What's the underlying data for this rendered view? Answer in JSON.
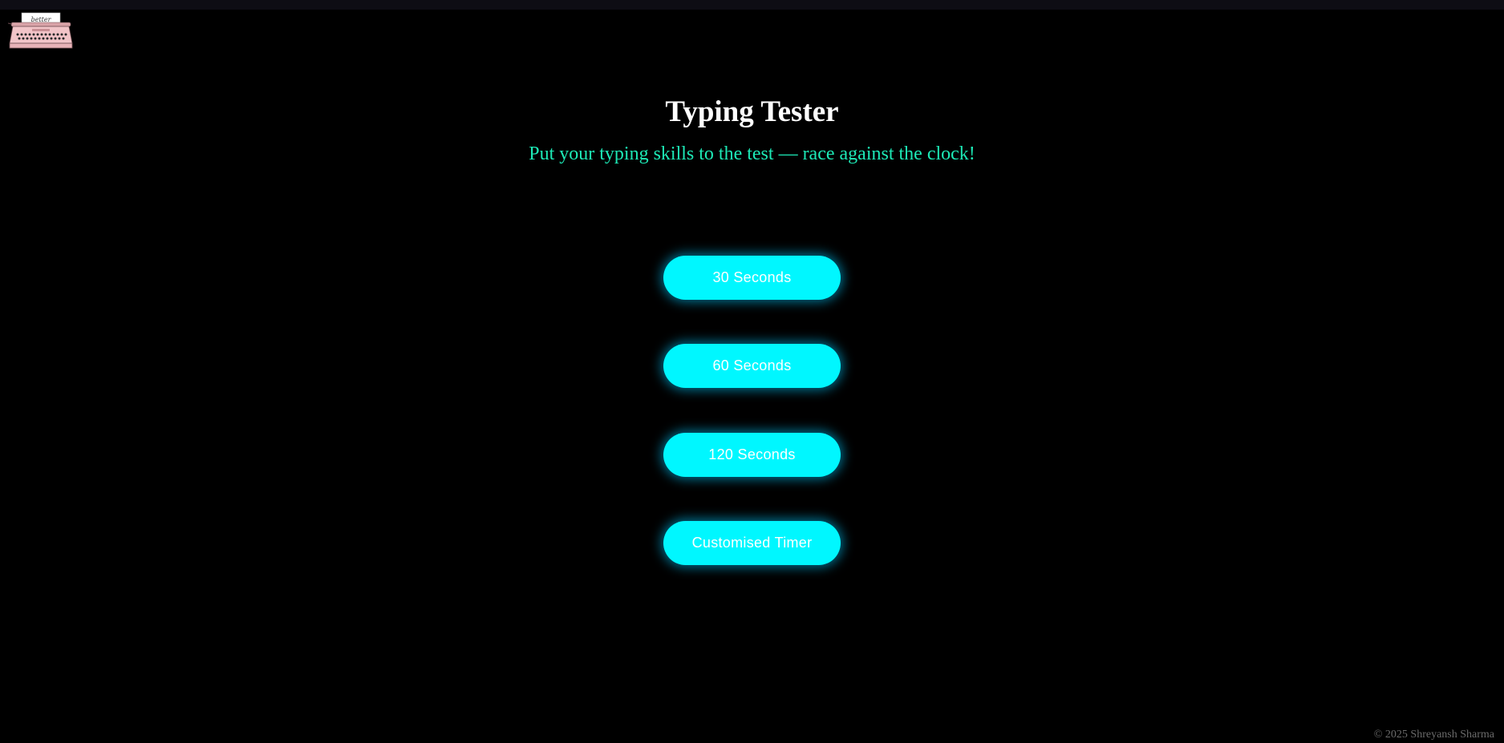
{
  "header": {
    "logo_icon": "typewriter-logo-icon",
    "logo_paper_text": "better"
  },
  "main": {
    "title": "Typing Tester",
    "subtitle": "Put your typing skills to the test — race against the clock!",
    "timer_options": [
      {
        "label": "30 Seconds"
      },
      {
        "label": "60 Seconds"
      },
      {
        "label": "120 Seconds"
      },
      {
        "label": "Customised Timer"
      }
    ]
  },
  "footer": {
    "copyright": "© 2025 Shreyansh Sharma"
  },
  "colors": {
    "background": "#000000",
    "topbar": "#0e0d14",
    "title": "#ffffff",
    "subtitle": "#1de9b6",
    "button": "#00f7ff",
    "button_text": "#ffffff",
    "footer_text": "#6b6b6b"
  }
}
